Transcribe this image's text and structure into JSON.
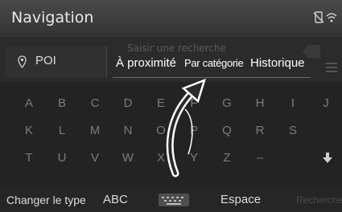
{
  "header": {
    "title": "Navigation"
  },
  "search": {
    "placeholder": "Saisir une recherche"
  },
  "poi": {
    "label": "POI"
  },
  "tabs": [
    {
      "label": "À proximité"
    },
    {
      "label": "Par catégorie"
    },
    {
      "label": "Historique"
    }
  ],
  "keyboard": {
    "row1": [
      "A",
      "B",
      "C",
      "D",
      "E",
      "F",
      "G",
      "H",
      "I",
      "J"
    ],
    "row2": [
      "K",
      "L",
      "M",
      "N",
      "O",
      "P",
      "Q",
      "R",
      "S"
    ],
    "row3": [
      "T",
      "U",
      "V",
      "W",
      "X",
      "Y",
      "Z",
      "–"
    ]
  },
  "bottom": {
    "change_type": "Changer le type",
    "abc": "ABC",
    "space": "Espace",
    "right_label": "Rechercher"
  },
  "icons": {
    "status_phone": "phone-disabled-icon",
    "status_wifi": "wifi-icon",
    "poi": "location-pin-icon",
    "backspace": "backspace-icon",
    "list": "list-icon",
    "keyboard": "keyboard-icon",
    "down": "down-arrow-icon"
  }
}
